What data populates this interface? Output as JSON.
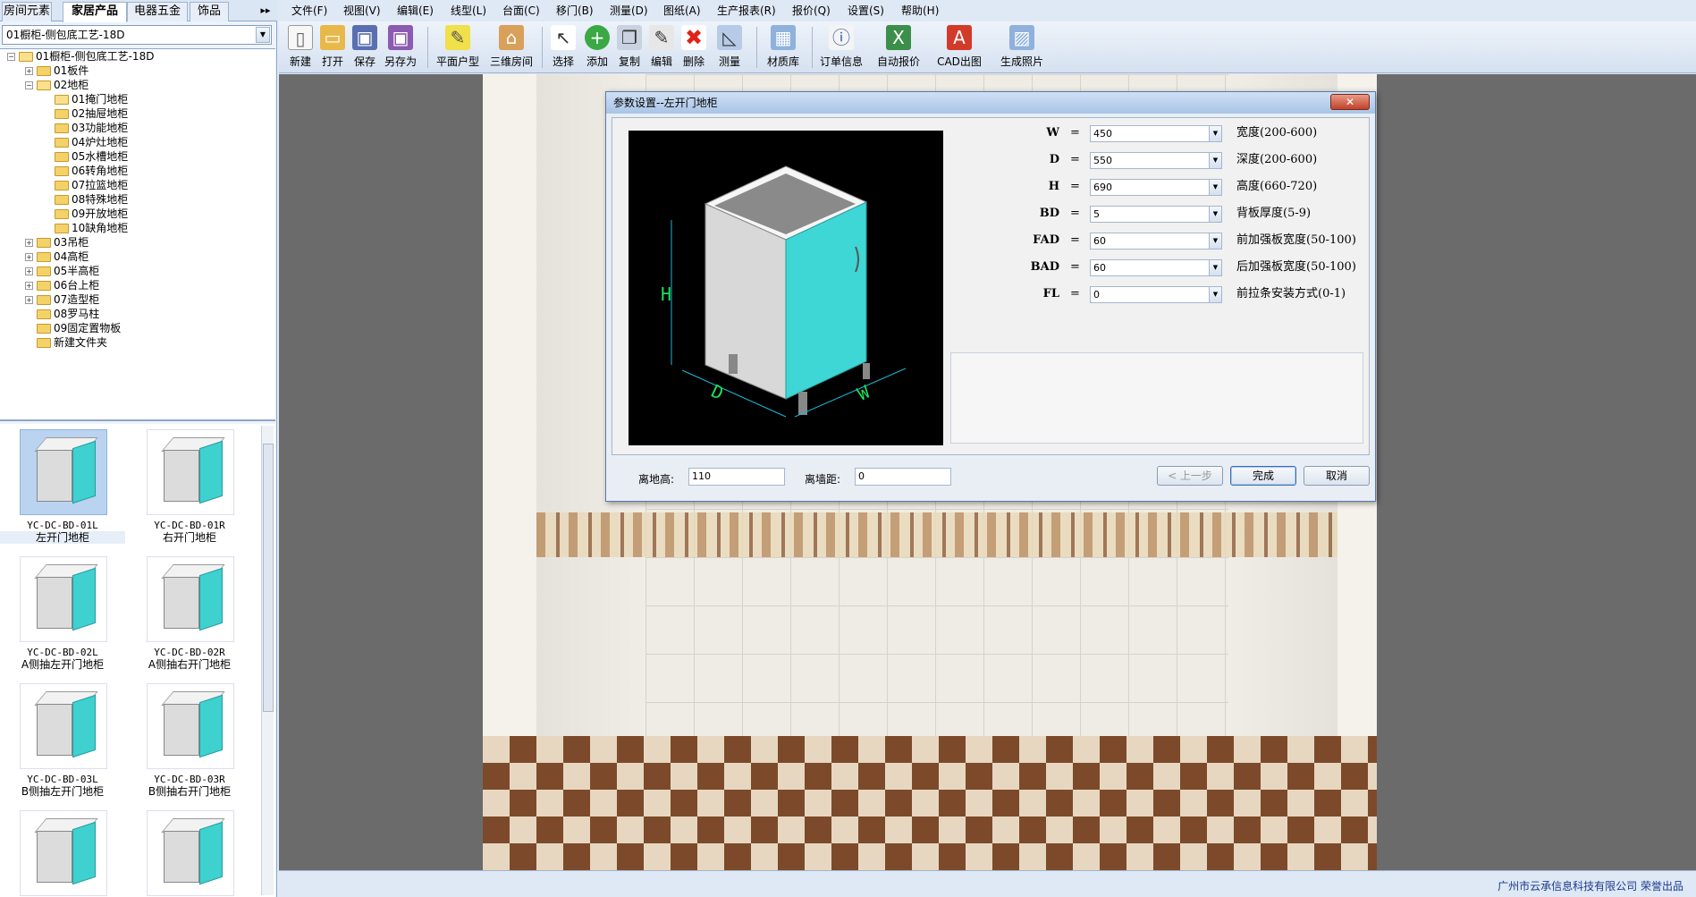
{
  "left_tabs": [
    "房间元素",
    "家居产品",
    "电器五金",
    "饰品"
  ],
  "left_tabs_more": "▸▸",
  "combo_value": "01橱柜-侧包底工艺-18D",
  "tree": [
    {
      "label": "01橱柜-侧包底工艺-18D",
      "exp": "−",
      "open": true,
      "level": 0
    },
    {
      "label": "01板件",
      "exp": "+",
      "open": false,
      "level": 1
    },
    {
      "label": "02地柜",
      "exp": "−",
      "open": true,
      "level": 1
    },
    {
      "label": "01掩门地柜",
      "exp": "",
      "open": true,
      "level": 2
    },
    {
      "label": "02抽屉地柜",
      "exp": "",
      "open": false,
      "level": 2
    },
    {
      "label": "03功能地柜",
      "exp": "",
      "open": false,
      "level": 2
    },
    {
      "label": "04炉灶地柜",
      "exp": "",
      "open": false,
      "level": 2
    },
    {
      "label": "05水槽地柜",
      "exp": "",
      "open": false,
      "level": 2
    },
    {
      "label": "06转角地柜",
      "exp": "",
      "open": false,
      "level": 2
    },
    {
      "label": "07拉篮地柜",
      "exp": "",
      "open": false,
      "level": 2
    },
    {
      "label": "08特殊地柜",
      "exp": "",
      "open": false,
      "level": 2
    },
    {
      "label": "09开放地柜",
      "exp": "",
      "open": false,
      "level": 2
    },
    {
      "label": "10缺角地柜",
      "exp": "",
      "open": false,
      "level": 2
    },
    {
      "label": "03吊柜",
      "exp": "+",
      "open": false,
      "level": 1
    },
    {
      "label": "04高柜",
      "exp": "+",
      "open": false,
      "level": 1
    },
    {
      "label": "05半高柜",
      "exp": "+",
      "open": false,
      "level": 1
    },
    {
      "label": "06台上柜",
      "exp": "+",
      "open": false,
      "level": 1
    },
    {
      "label": "07造型柜",
      "exp": "+",
      "open": false,
      "level": 1
    },
    {
      "label": "08罗马柱",
      "exp": "",
      "open": false,
      "level": 1
    },
    {
      "label": "09固定置物板",
      "exp": "",
      "open": false,
      "level": 1
    },
    {
      "label": "新建文件夹",
      "exp": "",
      "open": false,
      "level": 1
    }
  ],
  "thumbs": [
    {
      "code": "YC-DC-BD-01L",
      "name": "左开门地柜"
    },
    {
      "code": "YC-DC-BD-01R",
      "name": "右开门地柜"
    },
    {
      "code": "YC-DC-BD-02L",
      "name": "A侧抽左开门地柜"
    },
    {
      "code": "YC-DC-BD-02R",
      "name": "A侧抽右开门地柜"
    },
    {
      "code": "YC-DC-BD-03L",
      "name": "B侧抽左开门地柜"
    },
    {
      "code": "YC-DC-BD-03R",
      "name": "B侧抽右开门地柜"
    },
    {
      "code": "",
      "name": ""
    },
    {
      "code": "",
      "name": ""
    }
  ],
  "menu": [
    "文件(F)",
    "视图(V)",
    "编辑(E)",
    "线型(L)",
    "台面(C)",
    "移门(B)",
    "测量(D)",
    "图纸(A)",
    "生产报表(R)",
    "报价(Q)",
    "设置(S)",
    "帮助(H)"
  ],
  "toolbar": [
    {
      "label": "新建",
      "icon": "new-file-icon",
      "color": "#f7f7f7",
      "glyph": "▯"
    },
    {
      "label": "打开",
      "icon": "open-folder-icon",
      "color": "#e9b84a",
      "glyph": "▭"
    },
    {
      "label": "保存",
      "icon": "save-icon",
      "color": "#5a6fb0",
      "glyph": "▣"
    },
    {
      "label": "另存为",
      "icon": "save-as-icon",
      "color": "#8c5ab0",
      "glyph": "▣"
    },
    {
      "label": "平面户型",
      "icon": "floor-plan-icon",
      "color": "#f0e04a",
      "glyph": "✎"
    },
    {
      "label": "三维房间",
      "icon": "house-3d-icon",
      "color": "#d9a05a",
      "glyph": "⌂"
    },
    {
      "label": "选择",
      "icon": "select-cursor-icon",
      "color": "#ffffff",
      "glyph": "↖"
    },
    {
      "label": "添加",
      "icon": "add-icon",
      "color": "#3aa845",
      "glyph": "+"
    },
    {
      "label": "复制",
      "icon": "copy-icon",
      "color": "#c8d2e0",
      "glyph": "❐"
    },
    {
      "label": "编辑",
      "icon": "edit-icon",
      "color": "#e7e7e7",
      "glyph": "✎"
    },
    {
      "label": "删除",
      "icon": "delete-icon",
      "color": "#ffffff",
      "glyph": "✖"
    },
    {
      "label": "测量",
      "icon": "measure-icon",
      "color": "#b7cbe8",
      "glyph": "◺"
    },
    {
      "label": "材质库",
      "icon": "material-library-icon",
      "color": "#8fb1dc",
      "glyph": "▦"
    },
    {
      "label": "订单信息",
      "icon": "order-info-icon",
      "color": "#f4f4f4",
      "glyph": "ⓘ"
    },
    {
      "label": "自动报价",
      "icon": "auto-quote-icon",
      "color": "#3c8f4a",
      "glyph": "X"
    },
    {
      "label": "CAD出图",
      "icon": "cad-export-icon",
      "color": "#d23a2a",
      "glyph": "A"
    },
    {
      "label": "生成照片",
      "icon": "render-photo-icon",
      "color": "#8fb1dc",
      "glyph": "▨"
    }
  ],
  "dialog": {
    "title": "参数设置--左开门地柜",
    "close": "✕",
    "params": [
      {
        "name": "W",
        "value": "450",
        "desc": "宽度(200-600)"
      },
      {
        "name": "D",
        "value": "550",
        "desc": "深度(200-600)"
      },
      {
        "name": "H",
        "value": "690",
        "desc": "高度(660-720)"
      },
      {
        "name": "BD",
        "value": "5",
        "desc": "背板厚度(5-9)"
      },
      {
        "name": "FAD",
        "value": "60",
        "desc": "前加强板宽度(50-100)"
      },
      {
        "name": "BAD",
        "value": "60",
        "desc": "后加强板宽度(50-100)"
      },
      {
        "name": "FL",
        "value": "0",
        "desc": "前拉条安装方式(0-1)"
      }
    ],
    "eq": "=",
    "ground_label": "离地高:",
    "ground_value": "110",
    "wall_label": "离墙距:",
    "wall_value": "0",
    "prev": "< 上一步",
    "finish": "完成",
    "cancel": "取消",
    "preview_labels": {
      "h": "H",
      "d": "D",
      "w": "W"
    }
  },
  "status": "广州市云承信息科技有限公司 荣誉出品"
}
